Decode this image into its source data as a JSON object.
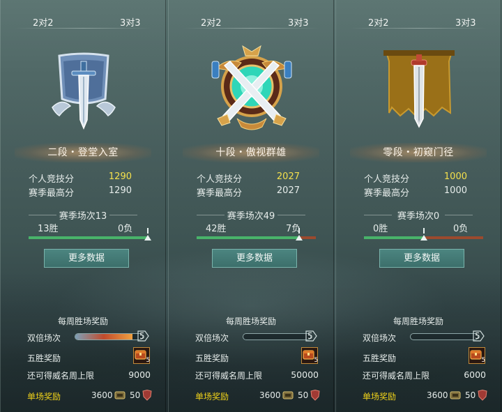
{
  "panels": [
    {
      "mode_left": "2对2",
      "mode_right": "3对3",
      "emblem": "bronze-banner-sword-emblem",
      "rank_title": "二段・登堂入室",
      "personal_score_label": "个人竞技分",
      "personal_score": "1290",
      "season_high_label": "赛季最高分",
      "season_high": "1290",
      "season_matches": "赛季场次13",
      "wins": "13胜",
      "losses": "0负",
      "win_ratio": 1.0,
      "more_data": "更多数据",
      "weekly_title": "每周胜场奖励",
      "double_label": "双倍场次",
      "double_count": "5",
      "double_progress": 0.85,
      "five_win_label": "五胜奖励",
      "chest_count": "5",
      "fame_label": "还可得威名周上限",
      "fame_cap": "9000",
      "single_label": "单场奖励",
      "single_coins": "3600",
      "single_shield": "50"
    },
    {
      "mode_left": "2对2",
      "mode_right": "3对3",
      "emblem": "crossed-swords-gold-emblem",
      "rank_title": "十段・傲视群雄",
      "personal_score_label": "个人竞技分",
      "personal_score": "2027",
      "season_high_label": "赛季最高分",
      "season_high": "2027",
      "season_matches": "赛季场次49",
      "wins": "42胜",
      "losses": "7负",
      "win_ratio": 0.857,
      "more_data": "更多数据",
      "weekly_title": "每周胜场奖励",
      "double_label": "双倍场次",
      "double_count": "5",
      "double_progress": 0.0,
      "five_win_label": "五胜奖励",
      "chest_count": "5",
      "fame_label": "还可得威名周上限",
      "fame_cap": "50000",
      "single_label": "单场奖励",
      "single_coins": "3600",
      "single_shield": "50"
    },
    {
      "mode_left": "2对2",
      "mode_right": "3对3",
      "emblem": "tattered-banner-sword-emblem",
      "rank_title": "零段・初窥门径",
      "personal_score_label": "个人竞技分",
      "personal_score": "1000",
      "season_high_label": "赛季最高分",
      "season_high": "1000",
      "season_matches": "赛季场次0",
      "wins": "0胜",
      "losses": "0负",
      "win_ratio": 0.5,
      "more_data": "更多数据",
      "weekly_title": "每周胜场奖励",
      "double_label": "双倍场次",
      "double_count": "5",
      "double_progress": 0.0,
      "five_win_label": "五胜奖励",
      "chest_count": "5",
      "fame_label": "还可得威名周上限",
      "fame_cap": "6000",
      "single_label": "单场奖励",
      "single_coins": "3600",
      "single_shield": "50"
    }
  ],
  "colors": {
    "highlight_score": "#f4e04c",
    "win_bar": "#49b36a",
    "loss_bar": "#9b4a2e",
    "single_label": "#f0d21a"
  }
}
